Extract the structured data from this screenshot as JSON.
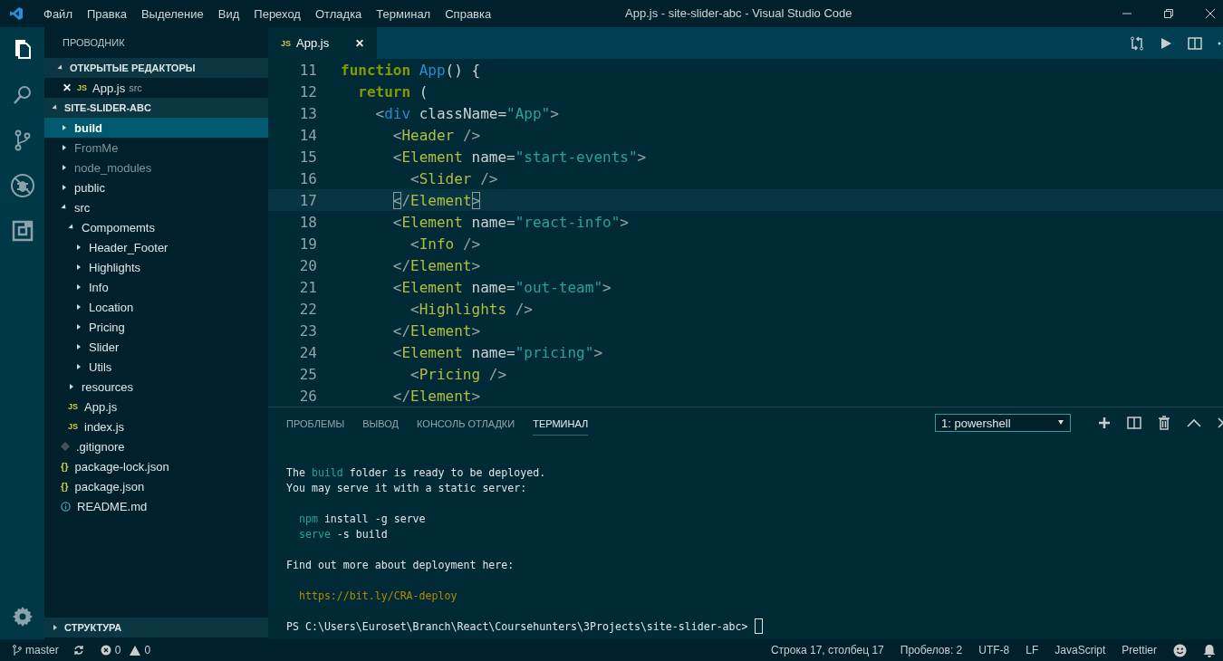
{
  "window": {
    "title": "App.js - site-slider-abc - Visual Studio Code"
  },
  "menu": [
    "Файл",
    "Правка",
    "Выделение",
    "Вид",
    "Переход",
    "Отладка",
    "Терминал",
    "Справка"
  ],
  "activity_bar": [
    {
      "kind": "files",
      "selected": true
    },
    {
      "kind": "search",
      "selected": false
    },
    {
      "kind": "source-control",
      "selected": false
    },
    {
      "kind": "debug",
      "selected": false
    },
    {
      "kind": "extensions",
      "selected": false
    }
  ],
  "explorer": {
    "title": "ПРОВОДНИК",
    "open_editors": {
      "title": "ОТКРЫТЫЕ РЕДАКТОРЫ",
      "expanded": true,
      "items": [
        {
          "close": "✕",
          "badge": "JS",
          "label": "App.js",
          "folder": "src"
        }
      ]
    },
    "project": {
      "title": "SITE-SLIDER-ABC",
      "expanded": true
    },
    "tree": [
      {
        "label": "build",
        "kind": "folder",
        "expanded": false,
        "selected": true,
        "ignored": false
      },
      {
        "label": "FromMe",
        "kind": "folder",
        "expanded": false,
        "selected": false,
        "ignored": true
      },
      {
        "label": "node_modules",
        "kind": "folder",
        "expanded": false,
        "selected": false,
        "ignored": true
      },
      {
        "label": "public",
        "kind": "folder",
        "expanded": false,
        "selected": false,
        "ignored": false
      },
      {
        "label": "src",
        "kind": "folder",
        "expanded": true,
        "selected": false,
        "ignored": false,
        "children": [
          {
            "label": "Compomemts",
            "kind": "folder",
            "expanded": true,
            "selected": false,
            "ignored": false,
            "children": [
              {
                "label": "Header_Footer",
                "kind": "folder",
                "expanded": false,
                "selected": false,
                "ignored": false
              },
              {
                "label": "Highlights",
                "kind": "folder",
                "expanded": false,
                "selected": false,
                "ignored": false
              },
              {
                "label": "Info",
                "kind": "folder",
                "expanded": false,
                "selected": false,
                "ignored": false
              },
              {
                "label": "Location",
                "kind": "folder",
                "expanded": false,
                "selected": false,
                "ignored": false
              },
              {
                "label": "Pricing",
                "kind": "folder",
                "expanded": false,
                "selected": false,
                "ignored": false
              },
              {
                "label": "Slider",
                "kind": "folder",
                "expanded": false,
                "selected": false,
                "ignored": false
              },
              {
                "label": "Utils",
                "kind": "folder",
                "expanded": false,
                "selected": false,
                "ignored": false
              }
            ]
          },
          {
            "label": "resources",
            "kind": "folder",
            "expanded": false,
            "selected": false,
            "ignored": false
          },
          {
            "label": "App.js",
            "kind": "js",
            "badge": "JS",
            "selected": false,
            "ignored": false
          },
          {
            "label": "index.js",
            "kind": "js",
            "badge": "JS",
            "selected": false,
            "ignored": false
          }
        ]
      },
      {
        "label": ".gitignore",
        "kind": "gitignore",
        "selected": false,
        "ignored": false
      },
      {
        "label": "package-lock.json",
        "kind": "json",
        "badge": "{}",
        "selected": false,
        "ignored": false
      },
      {
        "label": "package.json",
        "kind": "json",
        "badge": "{}",
        "selected": false,
        "ignored": false
      },
      {
        "label": "README.md",
        "kind": "info",
        "selected": false,
        "ignored": false
      }
    ],
    "outline": {
      "title": "СТРУКТУРА",
      "expanded": false
    }
  },
  "editor_tabs": [
    {
      "badge": "JS",
      "label": "App.js",
      "close": "✕",
      "selected": true
    }
  ],
  "code": [
    {
      "number": "11",
      "current": false,
      "tokens": [
        {
          "text": "function ",
          "kind": "keyword"
        },
        {
          "text": "App",
          "kind": "name"
        },
        {
          "text": "() {",
          "kind": "plain"
        }
      ]
    },
    {
      "number": "12",
      "current": false,
      "tokens": [
        {
          "text": "  return",
          "kind": "keyword"
        },
        {
          "text": " (",
          "kind": "plain"
        }
      ]
    },
    {
      "number": "13",
      "current": false,
      "tokens": [
        {
          "text": "    <",
          "kind": "punct"
        },
        {
          "text": "div",
          "kind": "html"
        },
        {
          "text": " className=",
          "kind": "attr"
        },
        {
          "text": "\"App\"",
          "kind": "string"
        },
        {
          "text": ">",
          "kind": "punct"
        }
      ]
    },
    {
      "number": "14",
      "current": false,
      "tokens": [
        {
          "text": "      <",
          "kind": "punct"
        },
        {
          "text": "Header",
          "kind": "component"
        },
        {
          "text": " />",
          "kind": "punct"
        }
      ]
    },
    {
      "number": "15",
      "current": false,
      "tokens": [
        {
          "text": "      <",
          "kind": "punct"
        },
        {
          "text": "Element",
          "kind": "component"
        },
        {
          "text": " name=",
          "kind": "attr"
        },
        {
          "text": "\"start-events\"",
          "kind": "string"
        },
        {
          "text": ">",
          "kind": "punct"
        }
      ]
    },
    {
      "number": "16",
      "current": false,
      "tokens": [
        {
          "text": "        <",
          "kind": "punct"
        },
        {
          "text": "Slider",
          "kind": "component"
        },
        {
          "text": " />",
          "kind": "punct"
        }
      ]
    },
    {
      "number": "17",
      "current": true,
      "tokens": [
        {
          "text": "      <",
          "kind": "punct",
          "bracket_match": true
        },
        {
          "text": "/",
          "kind": "punct"
        },
        {
          "text": "Element",
          "kind": "component"
        },
        {
          "text": ">",
          "kind": "punct",
          "bracket_match": true
        }
      ]
    },
    {
      "number": "18",
      "current": false,
      "tokens": [
        {
          "text": "      <",
          "kind": "punct"
        },
        {
          "text": "Element",
          "kind": "component"
        },
        {
          "text": " name=",
          "kind": "attr"
        },
        {
          "text": "\"react-info\"",
          "kind": "string"
        },
        {
          "text": ">",
          "kind": "punct"
        }
      ]
    },
    {
      "number": "19",
      "current": false,
      "tokens": [
        {
          "text": "        <",
          "kind": "punct"
        },
        {
          "text": "Info",
          "kind": "component"
        },
        {
          "text": " />",
          "kind": "punct"
        }
      ]
    },
    {
      "number": "20",
      "current": false,
      "tokens": [
        {
          "text": "      </",
          "kind": "punct"
        },
        {
          "text": "Element",
          "kind": "component"
        },
        {
          "text": ">",
          "kind": "punct"
        }
      ]
    },
    {
      "number": "21",
      "current": false,
      "tokens": [
        {
          "text": "      <",
          "kind": "punct"
        },
        {
          "text": "Element",
          "kind": "component"
        },
        {
          "text": " name=",
          "kind": "attr"
        },
        {
          "text": "\"out-team\"",
          "kind": "string"
        },
        {
          "text": ">",
          "kind": "punct"
        }
      ]
    },
    {
      "number": "22",
      "current": false,
      "tokens": [
        {
          "text": "        <",
          "kind": "punct"
        },
        {
          "text": "Highlights",
          "kind": "component"
        },
        {
          "text": " />",
          "kind": "punct"
        }
      ]
    },
    {
      "number": "23",
      "current": false,
      "tokens": [
        {
          "text": "      </",
          "kind": "punct"
        },
        {
          "text": "Element",
          "kind": "component"
        },
        {
          "text": ">",
          "kind": "punct"
        }
      ]
    },
    {
      "number": "24",
      "current": false,
      "tokens": [
        {
          "text": "      <",
          "kind": "punct"
        },
        {
          "text": "Element",
          "kind": "component"
        },
        {
          "text": " name=",
          "kind": "attr"
        },
        {
          "text": "\"pricing\"",
          "kind": "string"
        },
        {
          "text": ">",
          "kind": "punct"
        }
      ]
    },
    {
      "number": "25",
      "current": false,
      "tokens": [
        {
          "text": "        <",
          "kind": "punct"
        },
        {
          "text": "Pricing",
          "kind": "component"
        },
        {
          "text": " />",
          "kind": "punct"
        }
      ]
    },
    {
      "number": "26",
      "current": false,
      "tokens": [
        {
          "text": "      </",
          "kind": "punct"
        },
        {
          "text": "Element",
          "kind": "component"
        },
        {
          "text": ">",
          "kind": "punct"
        }
      ]
    }
  ],
  "panel": {
    "tabs": [
      {
        "label": "ПРОБЛЕМЫ",
        "selected": false
      },
      {
        "label": "ВЫВОД",
        "selected": false
      },
      {
        "label": "КОНСОЛЬ ОТЛАДКИ",
        "selected": false
      },
      {
        "label": "ТЕРМИНАЛ",
        "selected": true
      }
    ],
    "terminal_select": {
      "value": "1: powershell"
    },
    "terminal": [
      {
        "kind": "blank"
      },
      {
        "kind": "text",
        "tokens": [
          {
            "text": "The ",
            "kind": "plain"
          },
          {
            "text": "build",
            "kind": "accent"
          },
          {
            "text": " folder is ready to be deployed.",
            "kind": "plain"
          }
        ]
      },
      {
        "kind": "text",
        "tokens": [
          {
            "text": "You may serve it with a static server:",
            "kind": "plain"
          }
        ]
      },
      {
        "kind": "blank"
      },
      {
        "kind": "text",
        "tokens": [
          {
            "text": "  npm",
            "kind": "accent"
          },
          {
            "text": " install -g serve",
            "kind": "plain"
          }
        ]
      },
      {
        "kind": "text",
        "tokens": [
          {
            "text": "  serve",
            "kind": "accent"
          },
          {
            "text": " -s build",
            "kind": "plain"
          }
        ]
      },
      {
        "kind": "blank"
      },
      {
        "kind": "text",
        "tokens": [
          {
            "text": "Find out more about deployment here:",
            "kind": "plain"
          }
        ]
      },
      {
        "kind": "blank"
      },
      {
        "kind": "text",
        "tokens": [
          {
            "text": "  https://bit.ly/CRA-deploy",
            "kind": "link"
          }
        ]
      },
      {
        "kind": "blank"
      },
      {
        "kind": "prompt",
        "tokens": [
          {
            "text": "PS C:\\Users\\Euroset\\Branch\\React\\Coursehunters\\3Projects\\site-slider-abc> ",
            "kind": "plain"
          }
        ]
      }
    ]
  },
  "status_bar": {
    "branch": "master",
    "errors": "0",
    "warnings": "0",
    "right": [
      "Строка 17, столбец 17",
      "Пробелов: 2",
      "UTF-8",
      "LF",
      "JavaScript",
      "Prettier"
    ]
  }
}
